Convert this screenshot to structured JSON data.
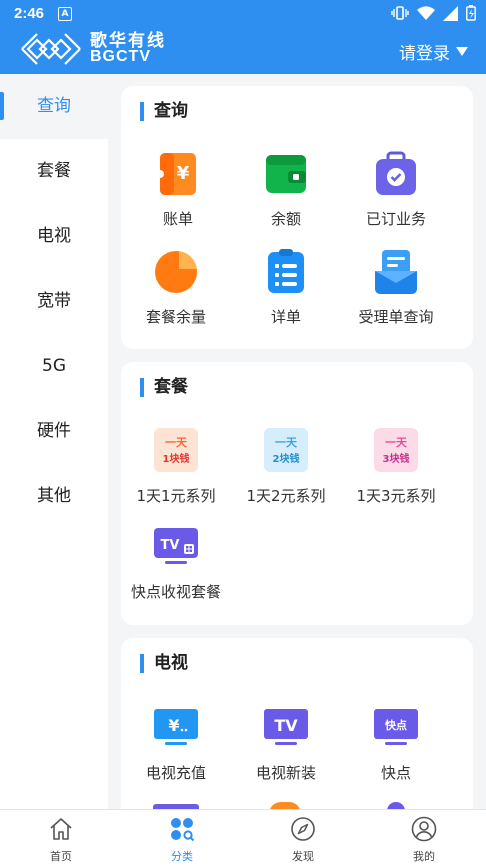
{
  "status_bar": {
    "time": "2:46",
    "notif_icon": "A"
  },
  "app_bar": {
    "logo_cn": "歌华有线",
    "logo_en": "BGCTV",
    "login_label": "请登录"
  },
  "sidebar": {
    "items": [
      {
        "label": "查询"
      },
      {
        "label": "套餐"
      },
      {
        "label": "电视"
      },
      {
        "label": "宽带"
      },
      {
        "label": "5G"
      },
      {
        "label": "硬件"
      },
      {
        "label": "其他"
      }
    ],
    "active_index": 0
  },
  "sections": {
    "query": {
      "title": "查询",
      "items": [
        {
          "label": "账单",
          "icon": "bill-icon"
        },
        {
          "label": "余额",
          "icon": "wallet-icon"
        },
        {
          "label": "已订业务",
          "icon": "subscribed-icon"
        },
        {
          "label": "套餐余量",
          "icon": "pie-chart-icon"
        },
        {
          "label": "详单",
          "icon": "detail-list-icon"
        },
        {
          "label": "受理单查询",
          "icon": "order-tray-icon"
        }
      ]
    },
    "package": {
      "title": "套餐",
      "items": [
        {
          "label": "1天1元系列",
          "icon": "one-day-one-yuan-icon",
          "badge_top": "一天",
          "badge_bottom": "1块钱"
        },
        {
          "label": "1天2元系列",
          "icon": "one-day-two-yuan-icon",
          "badge_top": "一天",
          "badge_bottom": "2块钱"
        },
        {
          "label": "1天3元系列",
          "icon": "one-day-three-yuan-icon",
          "badge_top": "一天",
          "badge_bottom": "3块钱"
        },
        {
          "label": "快点收视套餐",
          "icon": "tv-package-icon",
          "badge_top": "TV"
        }
      ]
    },
    "tv": {
      "title": "电视",
      "items": [
        {
          "label": "电视充值",
          "icon": "tv-recharge-icon",
          "badge_top": "¥"
        },
        {
          "label": "电视新装",
          "icon": "tv-install-icon",
          "badge_top": "TV"
        },
        {
          "label": "快点",
          "icon": "kuaidian-icon",
          "badge_top": "快点"
        }
      ]
    }
  },
  "bottom_nav": {
    "items": [
      {
        "label": "首页",
        "icon": "home-icon"
      },
      {
        "label": "分类",
        "icon": "category-icon"
      },
      {
        "label": "发现",
        "icon": "compass-icon"
      },
      {
        "label": "我的",
        "icon": "profile-icon"
      }
    ],
    "active_index": 1
  },
  "colors": {
    "primary": "#2f8ff0",
    "background": "#f4f5f7"
  }
}
